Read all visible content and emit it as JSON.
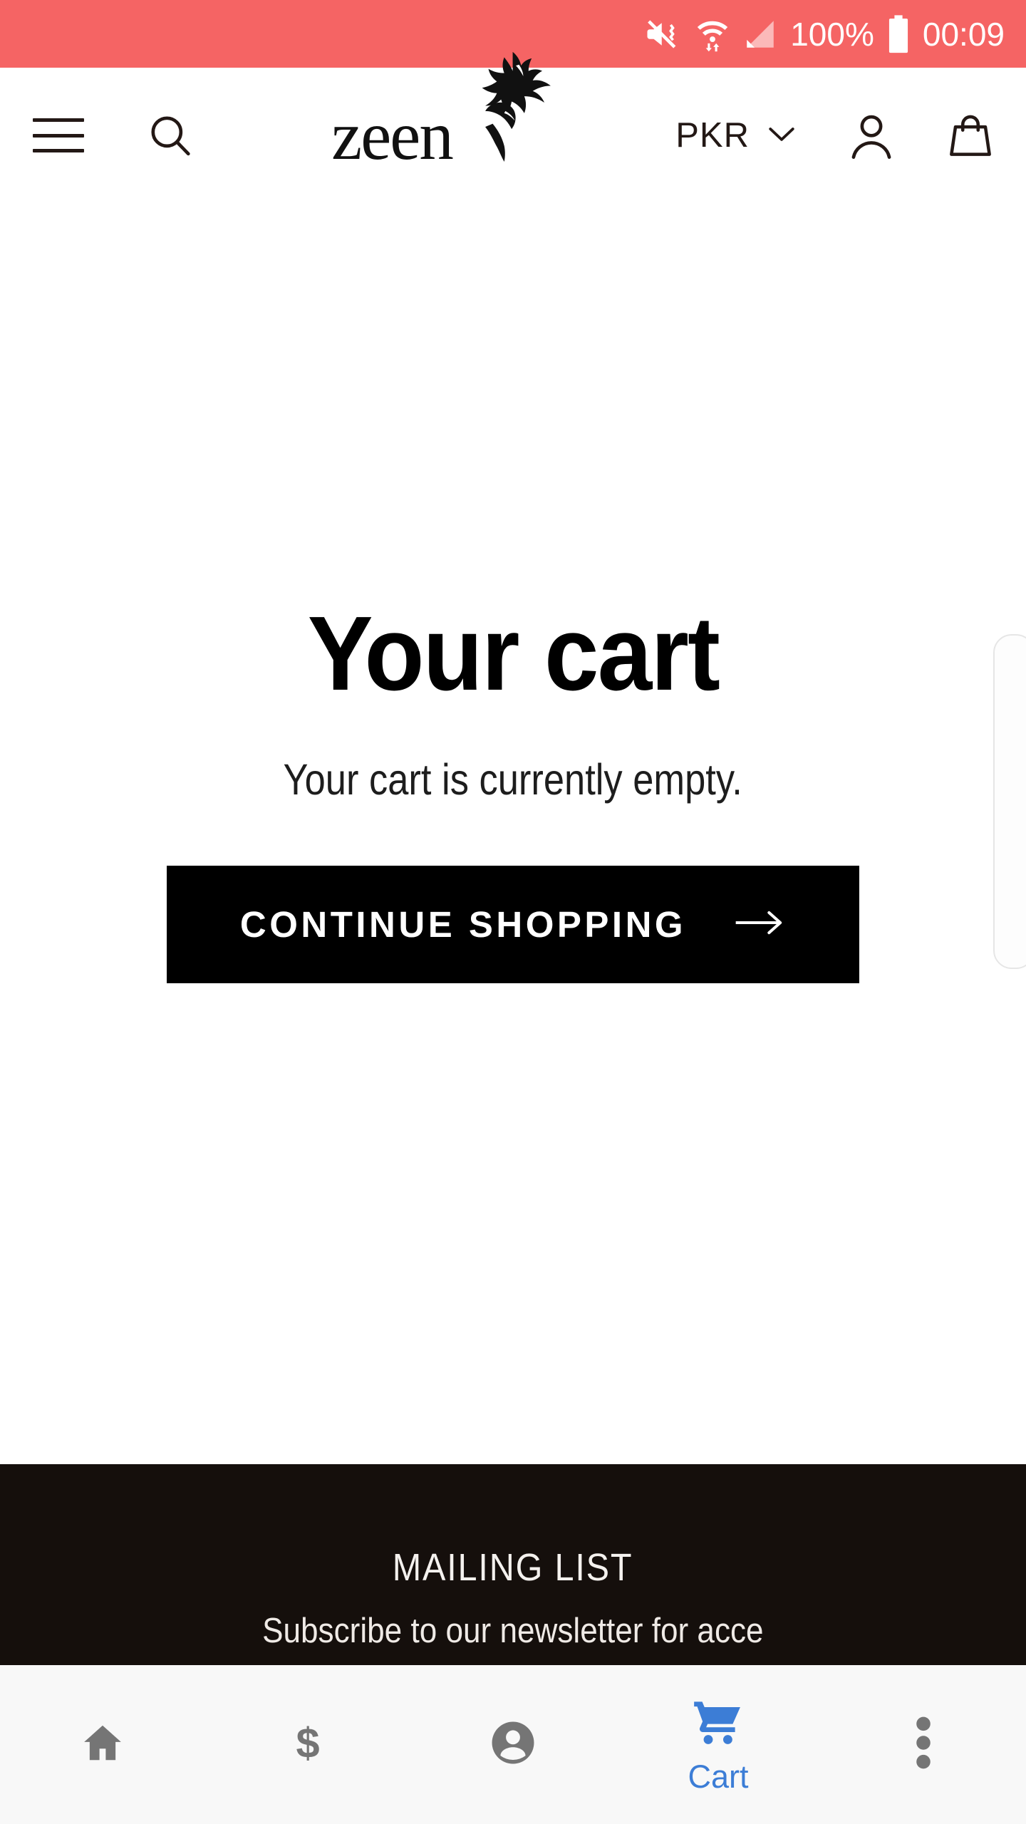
{
  "status_bar": {
    "background_color": "#F56464",
    "icons": [
      "mute-vibrate-icon",
      "wifi-icon",
      "cellular-signal-icon"
    ],
    "battery_percent": "100%",
    "battery_icon": "battery-full-icon",
    "time": "00:09"
  },
  "header": {
    "menu_icon": "hamburger-menu-icon",
    "search_icon": "search-icon",
    "logo_text": "zeen",
    "logo_mark": "floral-ornament-icon",
    "currency": {
      "label": "PKR",
      "chevron": "chevron-down-icon"
    },
    "account_icon": "account-person-icon",
    "bag_icon": "shopping-bag-icon"
  },
  "main": {
    "title": "Your cart",
    "empty_message": "Your cart is currently empty.",
    "cta": {
      "label": "CONTINUE SHOPPING",
      "arrow": "arrow-right-icon",
      "background_color": "#000000",
      "text_color": "#FFFFFF"
    }
  },
  "footer": {
    "background_color": "#150F0C",
    "title": "MAILING LIST",
    "subtitle": "Subscribe to our newsletter for acce"
  },
  "bottom_nav": {
    "background_color": "#F8F8F8",
    "active_color": "#3C7DD6",
    "inactive_color": "#757575",
    "items": [
      {
        "icon": "home-icon",
        "label": "",
        "active": false
      },
      {
        "icon": "dollar-sign-icon",
        "label": "",
        "active": false
      },
      {
        "icon": "account-circle-icon",
        "label": "",
        "active": false
      },
      {
        "icon": "shopping-cart-icon",
        "label": "Cart",
        "active": true
      },
      {
        "icon": "more-vertical-icon",
        "label": "",
        "active": false
      }
    ]
  }
}
